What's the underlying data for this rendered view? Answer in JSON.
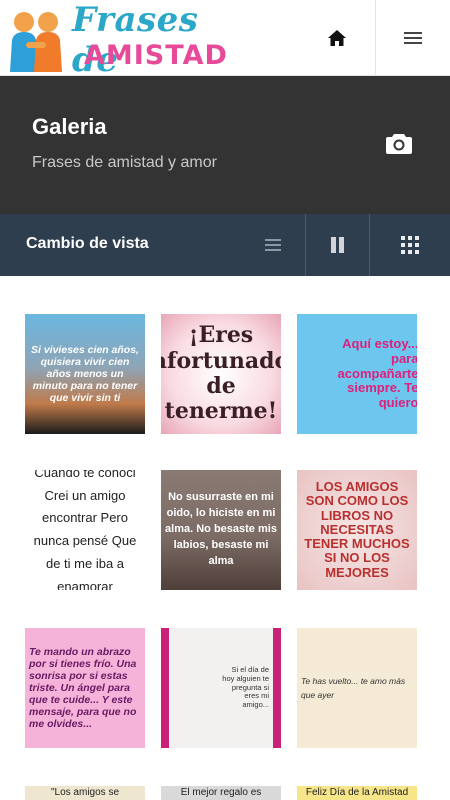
{
  "header": {
    "logo_line1": "Frases de",
    "logo_line2": "AMISTAD",
    "home_icon": "home-icon",
    "menu_icon": "hamburger-menu-icon"
  },
  "hero": {
    "title": "Galeria",
    "subtitle": "Frases de amistad y amor",
    "camera_icon": "camera-icon"
  },
  "viewbar": {
    "label": "Cambio de vista",
    "options": [
      "list-view-icon",
      "columns-view-icon",
      "grid-view-icon"
    ]
  },
  "gallery": {
    "tiles": [
      {
        "caption": "Si vivieses cien años, quisiera vivir cien años menos un minuto para no tener que vivir sin ti"
      },
      {
        "caption": "¡Eres afortunado de tenerme!"
      },
      {
        "caption": "Aquí estoy... para acompañarte siempre. Te quiero"
      },
      {
        "caption": "Cuando te conoci Crei un amigo encontrar Pero nunca pensé Que de ti me iba a enamorar"
      },
      {
        "caption": "No susurraste en mi oido, lo hiciste en mi alma. No besaste mis labios, besaste mi alma"
      },
      {
        "caption": "LOS AMIGOS SON COMO LOS LIBROS NO NECESITAS TENER MUCHOS SI NO LOS MEJORES"
      },
      {
        "caption": "Te mando un abrazo por si tienes frío. Una sonrisa por si estas triste. Un ángel para que te cuide... Y este mensaje, para que no me olvides..."
      },
      {
        "caption": "Si el día de hoy alguien te pregunta si eres mi amigo..."
      },
      {
        "caption": "Te has vuelto... te amo más que ayer"
      },
      {
        "caption": "\"Los amigos se"
      },
      {
        "caption": "El mejor regalo es"
      },
      {
        "caption": "Feliz Día de la Amistad"
      }
    ]
  }
}
